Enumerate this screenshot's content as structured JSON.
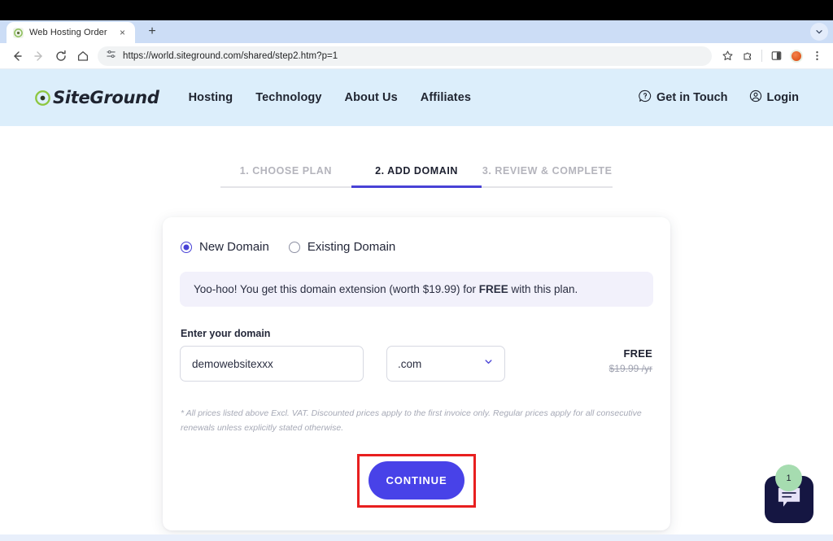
{
  "browser": {
    "tab": {
      "title": "Web Hosting Order",
      "favicon_name": "siteground-favicon",
      "close_label": "×"
    },
    "new_tab_label": "+",
    "url": "https://world.siteground.com/shared/step2.htm?p=1",
    "toolbar_icons": {
      "back": "back-arrow-icon",
      "forward": "forward-arrow-icon",
      "reload": "reload-icon",
      "home": "home-icon",
      "site_settings": "site-settings-icon",
      "bookmark": "star-icon",
      "extensions": "extensions-puzzle-icon",
      "split_screen": "split-screen-icon",
      "profile": "profile-avatar-icon",
      "menu": "three-dot-menu-icon",
      "tab_list": "tab-list-chevron-icon"
    }
  },
  "site_header": {
    "logo_text": "SiteGround",
    "nav": [
      {
        "label": "Hosting"
      },
      {
        "label": "Technology"
      },
      {
        "label": "About Us"
      },
      {
        "label": "Affiliates"
      }
    ],
    "actions": [
      {
        "label": "Get in Touch",
        "icon": "help-bubble-icon"
      },
      {
        "label": "Login",
        "icon": "user-circle-icon"
      }
    ]
  },
  "steps": [
    {
      "label": "1. CHOOSE PLAN",
      "active": false
    },
    {
      "label": "2. ADD DOMAIN",
      "active": true
    },
    {
      "label": "3. REVIEW & COMPLETE",
      "active": false
    }
  ],
  "card": {
    "domain_type": {
      "new_label": "New Domain",
      "existing_label": "Existing Domain",
      "selected": "new"
    },
    "promo": {
      "text_before": "Yoo-hoo! You get this domain extension (worth $19.99) for ",
      "highlight": "FREE",
      "text_after": " with this plan."
    },
    "field_label": "Enter your domain",
    "domain_value": "demowebsitexxx",
    "domain_placeholder": "Enter your domain",
    "tld_value": ".com",
    "price": {
      "free_label": "FREE",
      "old_price": "$19.99 /yr"
    },
    "fineprint": "* All prices listed above Excl. VAT. Discounted prices apply to the first invoice only. Regular prices apply for all consecutive renewals unless explicitly stated otherwise.",
    "continue_label": "CONTINUE"
  },
  "chat": {
    "badge_count": "1",
    "icon": "chat-bubble-icon"
  },
  "colors": {
    "accent_blue": "#4842e8",
    "accent_purple": "#4842d6",
    "header_bg": "#dceefb",
    "promo_bg": "#f2f1fb",
    "highlight_red": "#e81f1f",
    "chat_navy": "#151642",
    "badge_green": "#a6dcb0"
  }
}
